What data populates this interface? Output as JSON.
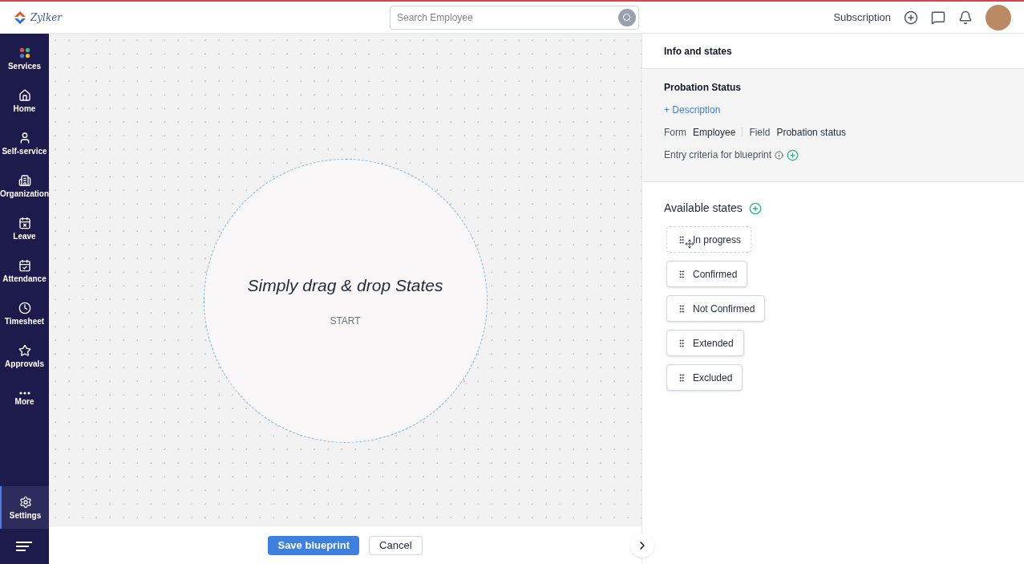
{
  "header": {
    "brand": "Zylker",
    "search": {
      "placeholder": "Search Employee"
    },
    "subscription": "Subscription"
  },
  "sidebar": {
    "items": [
      {
        "label": "Services",
        "selected": false
      },
      {
        "label": "Home",
        "selected": false
      },
      {
        "label": "Self-service",
        "selected": false
      },
      {
        "label": "Organization",
        "selected": false
      },
      {
        "label": "Leave",
        "selected": false
      },
      {
        "label": "Attendance",
        "selected": false
      },
      {
        "label": "Timesheet",
        "selected": false
      },
      {
        "label": "Approvals",
        "selected": false
      },
      {
        "label": "More",
        "selected": false
      }
    ],
    "bottom_item": {
      "label": "Settings",
      "selected": true
    }
  },
  "canvas": {
    "title": "Simply drag & drop States",
    "start": "START"
  },
  "footer": {
    "buttons": [
      "Save blueprint",
      "Cancel"
    ]
  },
  "panel": {
    "title": "Info and states",
    "name": "Probation Status",
    "description_link": "+ Description",
    "form_label": "Form",
    "form_value": "Employee",
    "field_label": "Field",
    "field_value": "Probation status",
    "entry_criteria": "Entry criteria for blueprint",
    "states_title": "Available states",
    "states": [
      {
        "label": "In progress",
        "dragging": true
      },
      {
        "label": "Confirmed",
        "dragging": false
      },
      {
        "label": "Not Confirmed",
        "dragging": false
      },
      {
        "label": "Extended",
        "dragging": false
      },
      {
        "label": "Excluded",
        "dragging": false
      }
    ]
  }
}
